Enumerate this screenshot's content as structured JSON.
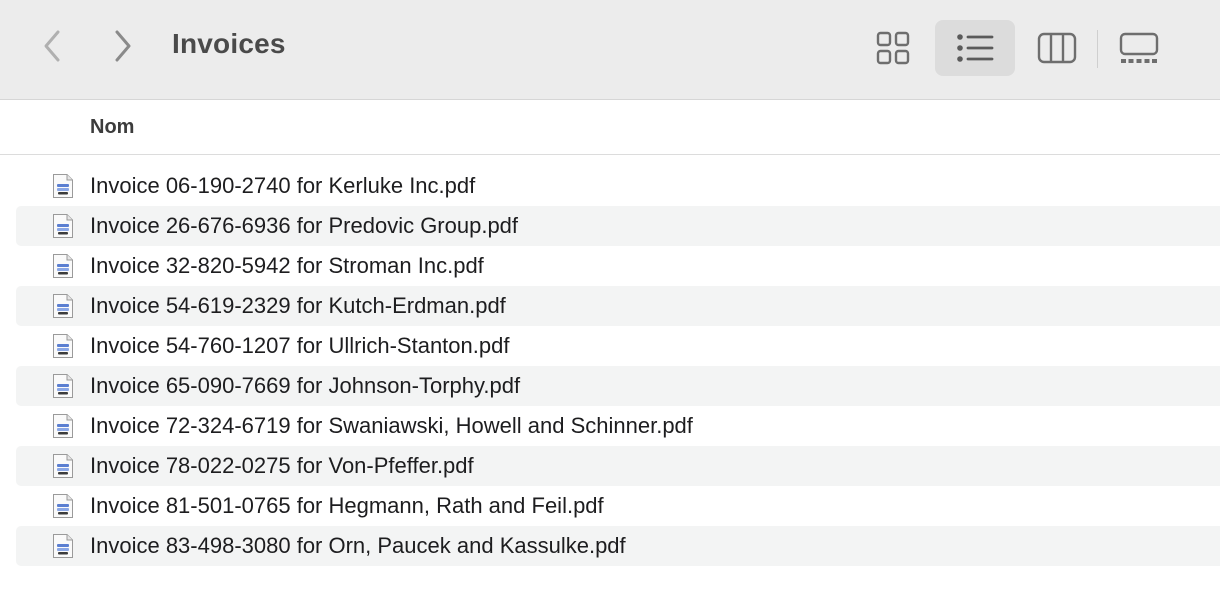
{
  "window": {
    "title": "Invoices"
  },
  "toolbar": {
    "back_icon": "chevron-left-icon",
    "forward_icon": "chevron-right-icon",
    "view_modes": [
      {
        "name": "icons",
        "icon": "grid-icon",
        "active": false
      },
      {
        "name": "list",
        "icon": "list-icon",
        "active": true
      },
      {
        "name": "columns",
        "icon": "columns-icon",
        "active": false
      },
      {
        "name": "gallery",
        "icon": "gallery-icon",
        "active": false
      }
    ]
  },
  "list_header": {
    "name_column": "Nom"
  },
  "files": [
    {
      "name": "Invoice 06-190-2740 for Kerluke Inc.pdf"
    },
    {
      "name": "Invoice 26-676-6936 for Predovic Group.pdf"
    },
    {
      "name": "Invoice 32-820-5942 for Stroman Inc.pdf"
    },
    {
      "name": "Invoice 54-619-2329 for Kutch-Erdman.pdf"
    },
    {
      "name": "Invoice 54-760-1207 for Ullrich-Stanton.pdf"
    },
    {
      "name": "Invoice 65-090-7669 for Johnson-Torphy.pdf"
    },
    {
      "name": "Invoice 72-324-6719 for Swaniawski, Howell and Schinner.pdf"
    },
    {
      "name": "Invoice 78-022-0275 for Von-Pfeffer.pdf"
    },
    {
      "name": "Invoice 81-501-0765 for Hegmann, Rath and Feil.pdf"
    },
    {
      "name": "Invoice 83-498-3080 for Orn, Paucek and Kassulke.pdf"
    }
  ],
  "colors": {
    "toolbar_bg": "#ececec",
    "active_view_bg": "#dcdcdc",
    "alt_row_bg": "#f3f4f4",
    "icon_gray": "#6e6e6e"
  }
}
